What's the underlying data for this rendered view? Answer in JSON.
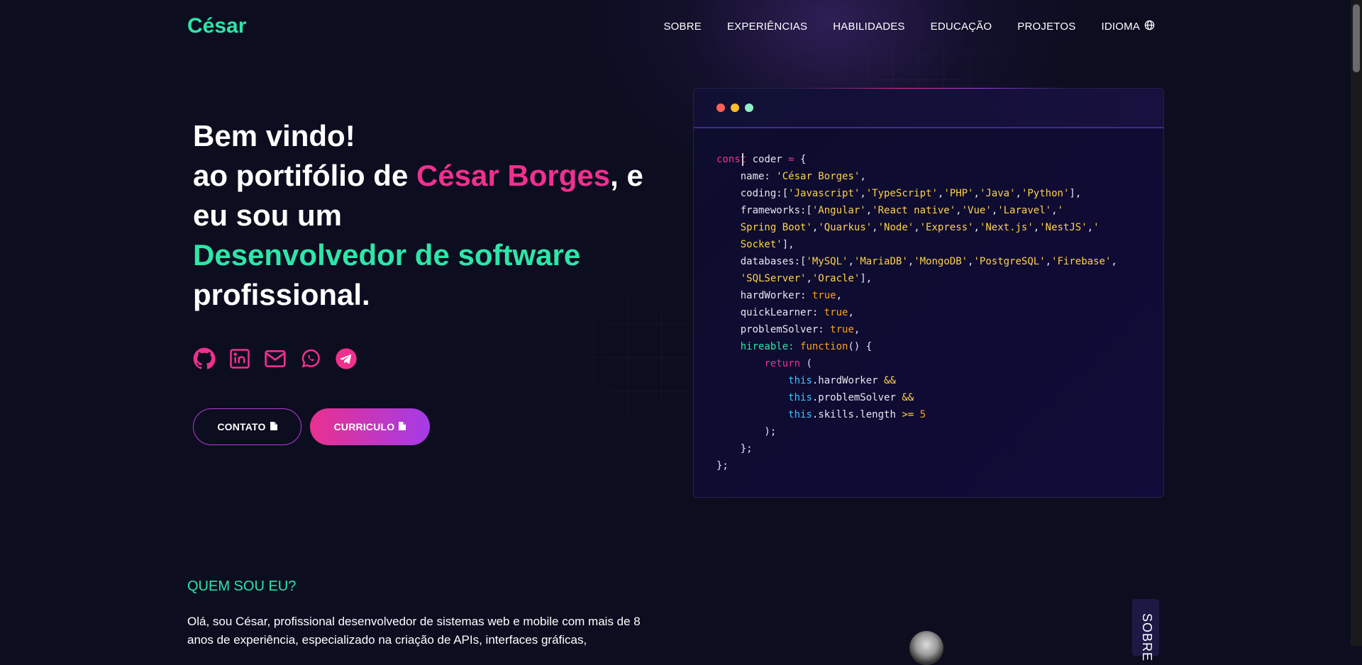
{
  "header": {
    "logo": "César",
    "nav": [
      "SOBRE",
      "EXPERIÊNCIAS",
      "HABILIDADES",
      "EDUCAÇÃO",
      "PROJETOS",
      "IDIOMA"
    ]
  },
  "hero": {
    "line1": "Bem vindo!",
    "line2_prefix": "ao portifólio de ",
    "name": "César Borges",
    "line2_suffix": ", e eu sou um",
    "role": "Desenvolvedor de software",
    "line_end": "profissional.",
    "socials": [
      "github-icon",
      "linkedin-icon",
      "email-icon",
      "whatsapp-icon",
      "telegram-icon"
    ],
    "buttons": {
      "contato": "CONTATO",
      "curriculo": "CURRICULO"
    }
  },
  "code_card": {
    "dots": [
      "#ff5f57",
      "#ffbd2e",
      "#8ff0c6"
    ]
  },
  "about": {
    "title": "QUEM SOU EU?",
    "text": "Olá, sou César, profissional desenvolvedor de sistemas web e mobile com mais de 8 anos de experiência, especializado na criação de APIs, interfaces gráficas,",
    "side_tab": "SOBRE"
  },
  "colors": {
    "accent_green": "#2ee6a8",
    "accent_pink": "#f0308f",
    "accent_purple": "#a43be8",
    "background": "#0d0d20"
  }
}
